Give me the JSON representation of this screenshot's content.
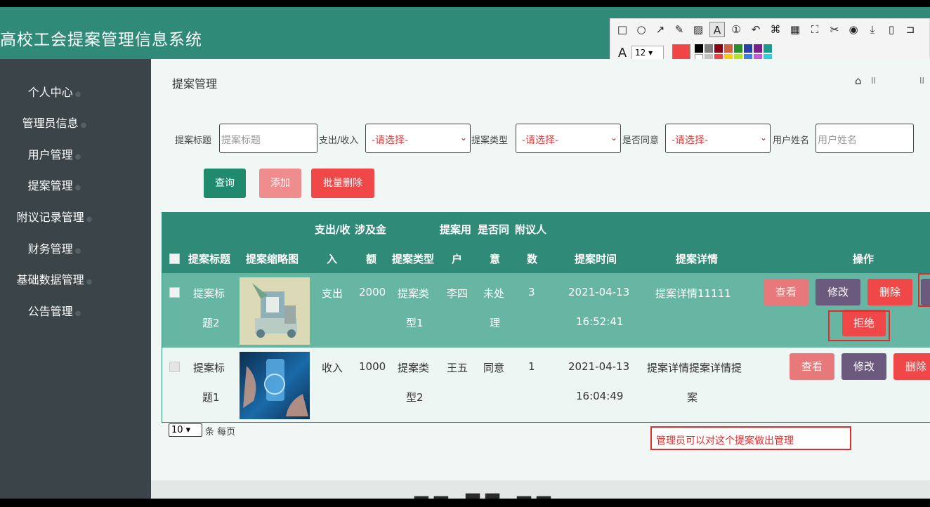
{
  "app": {
    "title": "高校工会提案管理信息系统"
  },
  "sidebar": {
    "items": [
      {
        "label": "个人中心"
      },
      {
        "label": "管理员信息"
      },
      {
        "label": "用户管理"
      },
      {
        "label": "提案管理"
      },
      {
        "label": "附议记录管理"
      },
      {
        "label": "财务管理"
      },
      {
        "label": "基础数据管理"
      },
      {
        "label": "公告管理"
      }
    ]
  },
  "page": {
    "title": "提案管理"
  },
  "filters": {
    "title_label": "提案标题",
    "title_placeholder": "提案标题",
    "inout_label": "支出/收入",
    "inout_value": "-请选择-",
    "type_label": "提案类型",
    "type_value": "-请选择-",
    "agree_label": "是否同意",
    "agree_value": "-请选择-",
    "user_label": "用户姓名",
    "user_placeholder": "用户姓名"
  },
  "actions": {
    "search": "查询",
    "add": "添加",
    "batch_delete": "批量删除"
  },
  "table": {
    "headers": {
      "title": "提案标题",
      "thumbnail": "提案缩略图",
      "inout": [
        "支出/收",
        "入"
      ],
      "amount": [
        "涉及金",
        "额"
      ],
      "type": "提案类型",
      "user": [
        "提案用",
        "户"
      ],
      "agree": [
        "是否同",
        "意"
      ],
      "seconds": [
        "附议人",
        "数"
      ],
      "time": "提案时间",
      "detail": "提案详情",
      "ops": "操作"
    },
    "rows": [
      {
        "title": [
          "提案标",
          "题2"
        ],
        "inout": "支出",
        "amount": "2000",
        "type": [
          "提案类",
          "型1"
        ],
        "user": "李四",
        "agree": [
          "未处",
          "理"
        ],
        "seconds": "3",
        "time": [
          "2021-04-13",
          "16:52:41"
        ],
        "detail": [
          "提案详情11111"
        ],
        "view": "查看",
        "edit": "修改",
        "delete": "删除",
        "reject": "拒绝"
      },
      {
        "title": [
          "提案标",
          "题1"
        ],
        "inout": "收入",
        "amount": "1000",
        "type": [
          "提案类",
          "型2"
        ],
        "user": "王五",
        "agree": [
          "同意"
        ],
        "seconds": "1",
        "time": [
          "2021-04-13",
          "16:04:49"
        ],
        "detail": [
          "提案详情提案详情提",
          "案"
        ],
        "view": "查看",
        "edit": "修改",
        "delete": "删除"
      }
    ]
  },
  "pager": {
    "page_size": "10",
    "suffix": "条 每页"
  },
  "annotation": {
    "note": "管理员可以对这个提案做出管理",
    "font_size": "12"
  },
  "colors": {
    "primary": "#2f8a78",
    "sidebar": "#3a4449",
    "view": "#e8797b",
    "edit": "#6c5a7e",
    "delete": "#f04848"
  }
}
